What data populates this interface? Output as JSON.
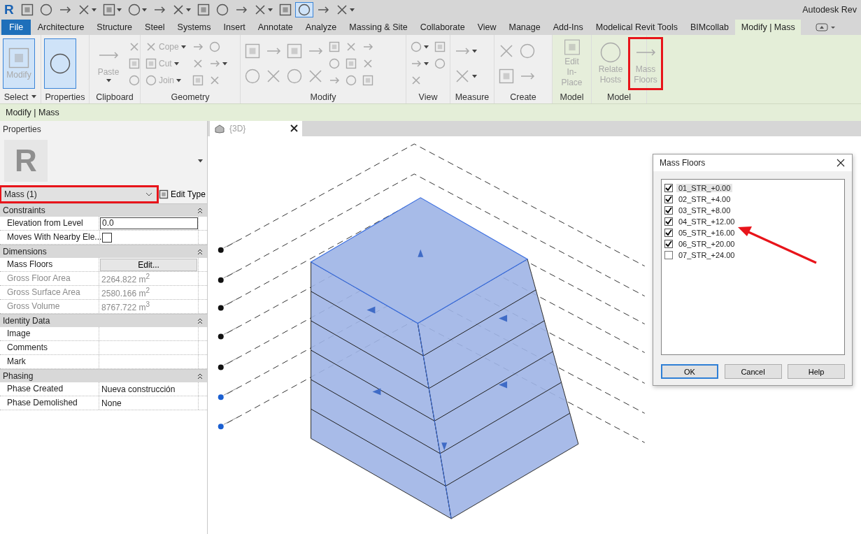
{
  "app": {
    "logo": "R",
    "title": "Autodesk Rev"
  },
  "quick_access": [
    {
      "dropdown": false,
      "pressed": false
    },
    {
      "dropdown": false,
      "pressed": false
    },
    {
      "dropdown": false,
      "pressed": false
    },
    {
      "dropdown": true,
      "pressed": false
    },
    {
      "dropdown": true,
      "pressed": false
    },
    {
      "dropdown": true,
      "pressed": false
    },
    {
      "dropdown": false,
      "pressed": false
    },
    {
      "dropdown": true,
      "pressed": false
    },
    {
      "dropdown": false,
      "pressed": false
    },
    {
      "dropdown": false,
      "pressed": false
    },
    {
      "dropdown": false,
      "pressed": false
    },
    {
      "dropdown": true,
      "pressed": false
    },
    {
      "dropdown": false,
      "pressed": false
    },
    {
      "dropdown": false,
      "pressed": true
    },
    {
      "dropdown": false,
      "pressed": false
    },
    {
      "dropdown": true,
      "pressed": false
    }
  ],
  "tabs": [
    {
      "label": "File",
      "kind": "file",
      "selected": false
    },
    {
      "label": "Architecture",
      "kind": "tab",
      "selected": false
    },
    {
      "label": "Structure",
      "kind": "tab",
      "selected": false
    },
    {
      "label": "Steel",
      "kind": "tab",
      "selected": false
    },
    {
      "label": "Systems",
      "kind": "tab",
      "selected": false
    },
    {
      "label": "Insert",
      "kind": "tab",
      "selected": false
    },
    {
      "label": "Annotate",
      "kind": "tab",
      "selected": false
    },
    {
      "label": "Analyze",
      "kind": "tab",
      "selected": false
    },
    {
      "label": "Massing & Site",
      "kind": "tab",
      "selected": false
    },
    {
      "label": "Collaborate",
      "kind": "tab",
      "selected": false
    },
    {
      "label": "View",
      "kind": "tab",
      "selected": false
    },
    {
      "label": "Manage",
      "kind": "tab",
      "selected": false
    },
    {
      "label": "Add-Ins",
      "kind": "tab",
      "selected": false
    },
    {
      "label": "Modelical Revit Tools",
      "kind": "tab",
      "selected": false
    },
    {
      "label": "BIMcollab",
      "kind": "tab",
      "selected": false
    },
    {
      "label": "Modify | Mass",
      "kind": "tab",
      "selected": true
    }
  ],
  "ribbon_panels": [
    {
      "label": "Select",
      "dropdown": true,
      "contextual": false,
      "buttons": [
        {
          "kind": "large",
          "label": "Modify",
          "selected": true,
          "disabled": true,
          "dropdown": false,
          "highlighted": false
        }
      ]
    },
    {
      "label": "Properties",
      "dropdown": false,
      "contextual": false,
      "buttons": [
        {
          "kind": "large",
          "selected": true,
          "disabled": false,
          "dropdown": false,
          "highlighted": false
        }
      ]
    },
    {
      "label": "Clipboard",
      "dropdown": false,
      "contextual": false,
      "buttons": [
        {
          "kind": "large",
          "label": "Paste",
          "selected": false,
          "disabled": true,
          "dropdown": true,
          "highlighted": false
        },
        {
          "kind": "small",
          "selected": false,
          "disabled": true,
          "dropdown": false,
          "highlighted": false
        },
        {
          "kind": "small",
          "selected": false,
          "disabled": true,
          "dropdown": false,
          "highlighted": false
        },
        {
          "kind": "small",
          "selected": false,
          "disabled": true,
          "dropdown": false,
          "highlighted": false
        }
      ]
    },
    {
      "label": "Geometry",
      "dropdown": false,
      "contextual": false,
      "buttons": [
        {
          "kind": "small",
          "label": "Cope",
          "selected": false,
          "disabled": true,
          "dropdown": true,
          "highlighted": false
        },
        {
          "kind": "small",
          "label": "Cut",
          "selected": false,
          "disabled": true,
          "dropdown": true,
          "highlighted": false
        },
        {
          "kind": "small",
          "label": "Join",
          "selected": false,
          "disabled": true,
          "dropdown": true,
          "highlighted": false
        },
        {
          "kind": "small",
          "selected": false,
          "disabled": true,
          "dropdown": false,
          "highlighted": false
        },
        {
          "kind": "small",
          "selected": false,
          "disabled": true,
          "dropdown": false,
          "highlighted": false
        },
        {
          "kind": "small",
          "selected": false,
          "disabled": true,
          "dropdown": false,
          "highlighted": false
        },
        {
          "kind": "small",
          "selected": false,
          "disabled": true,
          "dropdown": false,
          "highlighted": false
        },
        {
          "kind": "small",
          "selected": false,
          "disabled": true,
          "dropdown": true,
          "highlighted": false
        },
        {
          "kind": "small",
          "selected": false,
          "disabled": true,
          "dropdown": false,
          "highlighted": false
        }
      ]
    },
    {
      "label": "Modify",
      "dropdown": false,
      "contextual": false,
      "buttons": [
        {
          "kind": "medium",
          "selected": false,
          "disabled": true,
          "dropdown": false,
          "highlighted": false
        },
        {
          "kind": "medium",
          "selected": false,
          "disabled": true,
          "dropdown": false,
          "highlighted": false
        },
        {
          "kind": "medium",
          "selected": false,
          "disabled": true,
          "dropdown": false,
          "highlighted": false
        },
        {
          "kind": "medium",
          "selected": false,
          "disabled": true,
          "dropdown": false,
          "highlighted": false
        },
        {
          "kind": "medium",
          "selected": false,
          "disabled": true,
          "dropdown": false,
          "highlighted": false
        },
        {
          "kind": "medium",
          "selected": false,
          "disabled": true,
          "dropdown": false,
          "highlighted": false
        },
        {
          "kind": "medium",
          "selected": false,
          "disabled": true,
          "dropdown": false,
          "highlighted": false
        },
        {
          "kind": "medium",
          "selected": false,
          "disabled": true,
          "dropdown": false,
          "highlighted": false
        },
        {
          "kind": "small",
          "selected": false,
          "disabled": true,
          "dropdown": false,
          "highlighted": false
        },
        {
          "kind": "small",
          "selected": false,
          "disabled": true,
          "dropdown": false,
          "highlighted": false
        },
        {
          "kind": "small",
          "selected": false,
          "disabled": true,
          "dropdown": false,
          "highlighted": false
        },
        {
          "kind": "small",
          "selected": false,
          "disabled": true,
          "dropdown": false,
          "highlighted": false
        },
        {
          "kind": "small",
          "selected": false,
          "disabled": true,
          "dropdown": false,
          "highlighted": false
        },
        {
          "kind": "small",
          "selected": false,
          "disabled": true,
          "dropdown": false,
          "highlighted": false
        },
        {
          "kind": "small",
          "selected": false,
          "disabled": true,
          "dropdown": false,
          "highlighted": false
        },
        {
          "kind": "small",
          "selected": false,
          "disabled": true,
          "dropdown": false,
          "highlighted": false
        },
        {
          "kind": "small",
          "selected": false,
          "disabled": true,
          "dropdown": false,
          "highlighted": false
        }
      ]
    },
    {
      "label": "View",
      "dropdown": false,
      "contextual": false,
      "buttons": [
        {
          "kind": "small",
          "selected": false,
          "disabled": true,
          "dropdown": true,
          "highlighted": false
        },
        {
          "kind": "small",
          "selected": false,
          "disabled": true,
          "dropdown": true,
          "highlighted": false
        },
        {
          "kind": "small",
          "selected": false,
          "disabled": true,
          "dropdown": false,
          "highlighted": false
        },
        {
          "kind": "small",
          "selected": false,
          "disabled": true,
          "dropdown": false,
          "highlighted": false
        },
        {
          "kind": "small",
          "selected": false,
          "disabled": true,
          "dropdown": false,
          "highlighted": false
        }
      ]
    },
    {
      "label": "Measure",
      "dropdown": false,
      "contextual": false,
      "buttons": [
        {
          "kind": "medium",
          "selected": false,
          "disabled": true,
          "dropdown": true,
          "highlighted": false
        },
        {
          "kind": "medium",
          "selected": false,
          "disabled": true,
          "dropdown": true,
          "highlighted": false
        }
      ]
    },
    {
      "label": "Create",
      "dropdown": false,
      "contextual": false,
      "buttons": [
        {
          "kind": "medium",
          "selected": false,
          "disabled": true,
          "dropdown": false,
          "highlighted": false
        },
        {
          "kind": "medium",
          "selected": false,
          "disabled": true,
          "dropdown": false,
          "highlighted": false
        },
        {
          "kind": "medium",
          "selected": false,
          "disabled": true,
          "dropdown": false,
          "highlighted": false
        },
        {
          "kind": "medium",
          "selected": false,
          "disabled": true,
          "dropdown": false,
          "highlighted": false
        }
      ]
    },
    {
      "label": "Model",
      "dropdown": false,
      "contextual": true,
      "buttons": [
        {
          "kind": "large",
          "label": "Edit\nIn-Place",
          "selected": false,
          "disabled": true,
          "dropdown": false,
          "highlighted": false
        }
      ]
    },
    {
      "label": "Model",
      "dropdown": false,
      "contextual": true,
      "buttons": [
        {
          "kind": "large",
          "label": "Relate\nHosts",
          "selected": false,
          "disabled": true,
          "dropdown": false,
          "highlighted": false
        },
        {
          "kind": "large",
          "label": "Mass\nFloors",
          "selected": false,
          "disabled": true,
          "dropdown": false,
          "highlighted": true
        }
      ]
    }
  ],
  "context_bar": "Modify | Mass",
  "properties": {
    "title": "Properties",
    "type_preview": "R",
    "type_selector": {
      "value": "Mass (1)",
      "highlighted": true
    },
    "edit_type": "Edit Type",
    "groups": [
      {
        "name": "Constraints",
        "expanded": true,
        "rows": [
          {
            "label": "Elevation from Level",
            "kind": "input",
            "value": "0.0",
            "disabled": false
          },
          {
            "label": "Moves With Nearby Ele...",
            "kind": "checkbox",
            "checked": false,
            "disabled": false
          }
        ]
      },
      {
        "name": "Dimensions",
        "expanded": true,
        "rows": [
          {
            "label": "Mass Floors",
            "kind": "button",
            "value": "Edit...",
            "disabled": false
          },
          {
            "label": "Gross Floor Area",
            "kind": "text",
            "value": "2264.822 m$^{2}$",
            "disabled": true
          },
          {
            "label": "Gross Surface Area",
            "kind": "text",
            "value": "2580.166 m$^{2}$",
            "disabled": true
          },
          {
            "label": "Gross Volume",
            "kind": "text",
            "value": "8767.722 m$^{3}$",
            "disabled": true
          }
        ]
      },
      {
        "name": "Identity Data",
        "expanded": true,
        "rows": [
          {
            "label": "Image",
            "kind": "text",
            "disabled": false
          },
          {
            "label": "Comments",
            "kind": "text",
            "disabled": false
          },
          {
            "label": "Mark",
            "kind": "text",
            "disabled": false
          }
        ]
      },
      {
        "name": "Phasing",
        "expanded": true,
        "rows": [
          {
            "label": "Phase Created",
            "kind": "text",
            "value": "Nueva construcción",
            "disabled": false
          },
          {
            "label": "Phase Demolished",
            "kind": "text",
            "value": "None",
            "disabled": false
          }
        ]
      }
    ]
  },
  "view_tab": {
    "label": "{3D}",
    "selected": false
  },
  "dialog": {
    "title": "Mass Floors",
    "levels": [
      {
        "name": "01_STR_+0.00",
        "checked": true,
        "selected": true
      },
      {
        "name": "02_STR_+4.00",
        "checked": true,
        "selected": false
      },
      {
        "name": "03_STR_+8.00",
        "checked": true,
        "selected": false
      },
      {
        "name": "04_STR_+12.00",
        "checked": true,
        "selected": false
      },
      {
        "name": "05_STR_+16.00",
        "checked": true,
        "selected": false
      },
      {
        "name": "06_STR_+20.00",
        "checked": true,
        "selected": false
      },
      {
        "name": "07_STR_+24.00",
        "checked": false,
        "selected": false
      }
    ],
    "buttons": [
      {
        "label": "OK",
        "default": true
      },
      {
        "label": "Cancel",
        "default": false
      },
      {
        "label": "Help",
        "default": false
      }
    ]
  }
}
